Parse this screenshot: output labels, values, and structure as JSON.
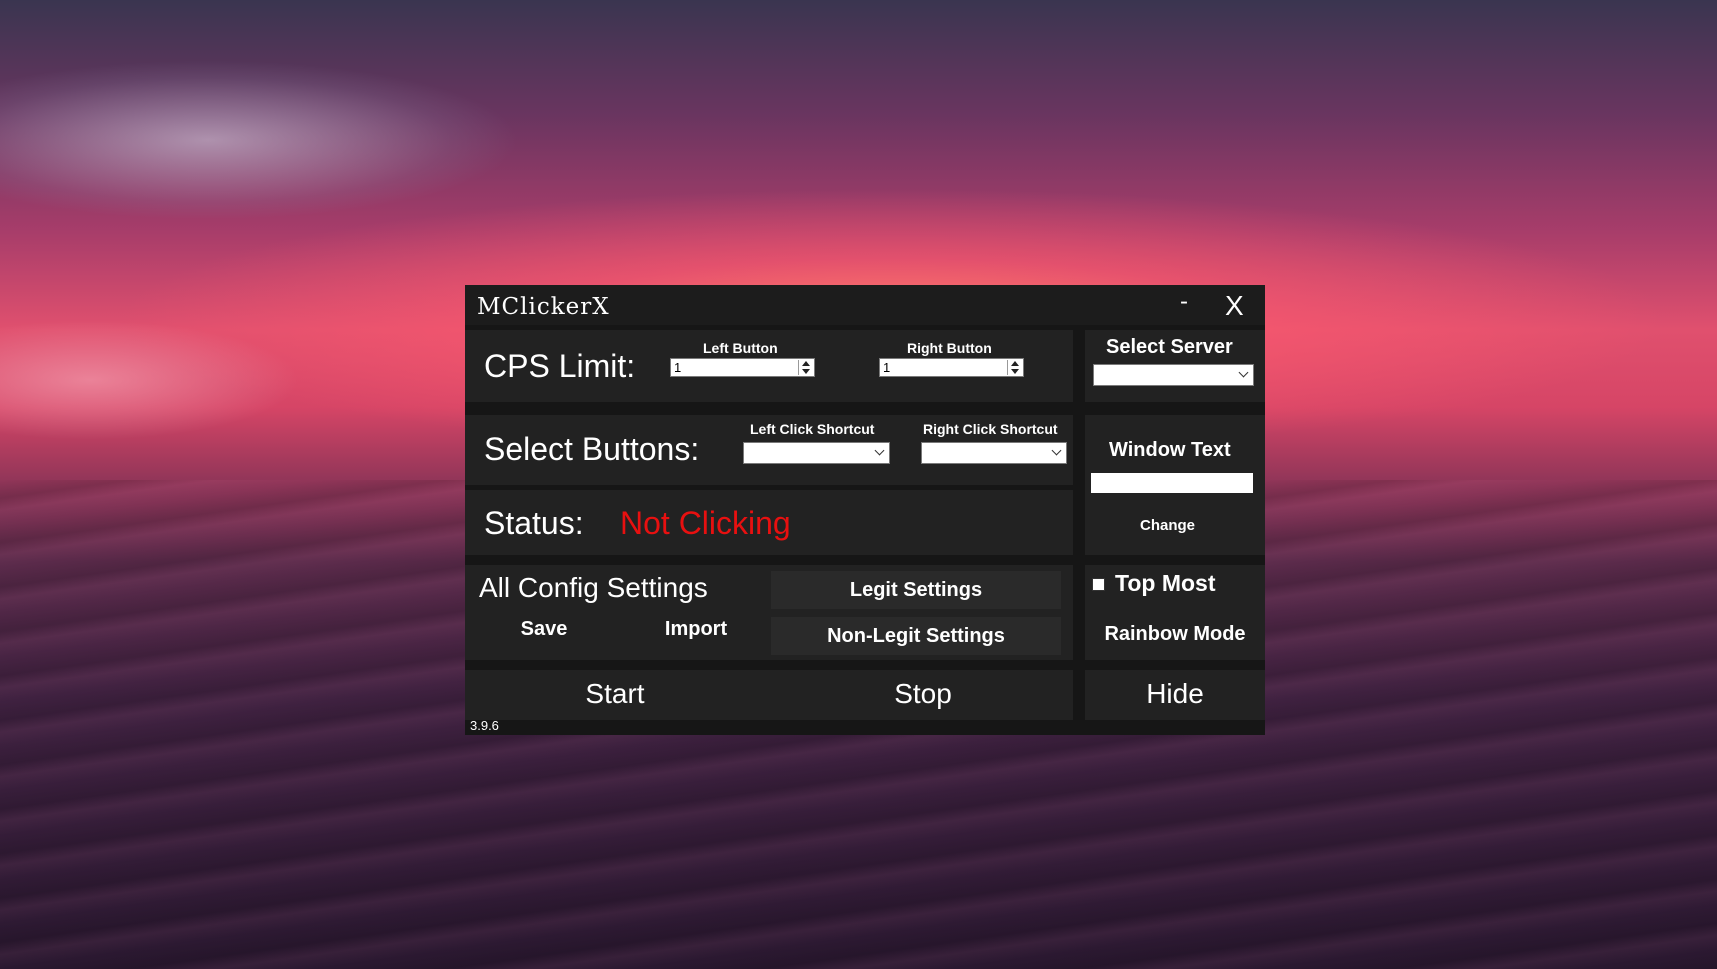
{
  "window": {
    "title": "MClickerX",
    "minimize_label": "-",
    "close_label": "X",
    "version": "3.9.6"
  },
  "cps": {
    "label": "CPS Limit:",
    "left_label": "Left Button",
    "left_value": "1",
    "right_label": "Right Button",
    "right_value": "1"
  },
  "server": {
    "label": "Select Server",
    "value": ""
  },
  "buttons": {
    "label": "Select Buttons:",
    "left_shortcut_label": "Left Click Shortcut",
    "left_shortcut_value": "",
    "right_shortcut_label": "Right Click Shortcut",
    "right_shortcut_value": ""
  },
  "window_text": {
    "label": "Window Text",
    "value": "",
    "change_label": "Change"
  },
  "status": {
    "label": "Status:",
    "value": "Not Clicking",
    "color": "#e81010"
  },
  "config": {
    "label": "All Config Settings",
    "save_label": "Save",
    "import_label": "Import"
  },
  "settings": {
    "legit_label": "Legit Settings",
    "non_legit_label": "Non-Legit Settings"
  },
  "options": {
    "top_most_label": "Top Most",
    "top_most_checked": false,
    "rainbow_label": "Rainbow Mode"
  },
  "actions": {
    "start_label": "Start",
    "stop_label": "Stop",
    "hide_label": "Hide"
  }
}
